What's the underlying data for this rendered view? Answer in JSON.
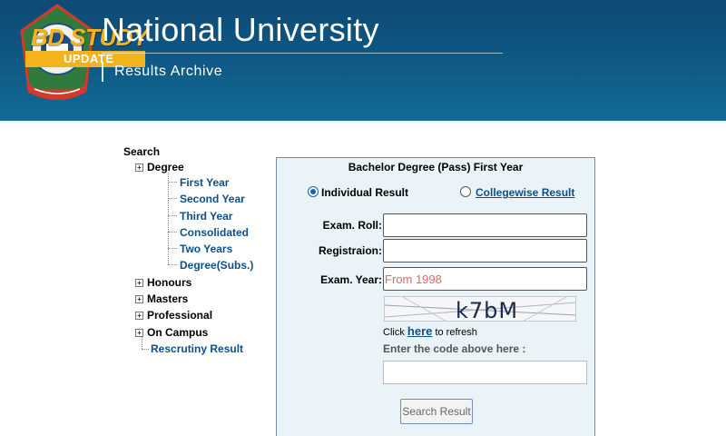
{
  "header": {
    "title": "National University",
    "subtitle": "Results Archive",
    "watermark": {
      "brand": "BD STUDY",
      "update": "UPDATE"
    }
  },
  "sidebar": {
    "root": "Search",
    "degree": {
      "label": "Degree",
      "items": [
        "First Year",
        "Second Year",
        "Third Year",
        "Consolidated",
        "Two Years",
        "Degree(Subs.)"
      ]
    },
    "categories": [
      "Honours",
      "Masters",
      "Professional",
      "On Campus"
    ],
    "rescrutiny": "Rescrutiny Result"
  },
  "form": {
    "title": "Bachelor Degree (Pass) First Year",
    "mode_individual": "Individual Result",
    "mode_collegewise": "Collegewise Result",
    "selected_mode": "Individual Result",
    "roll_label": "Exam. Roll:",
    "roll_value": "",
    "registration_label": "Registraion:",
    "registration_value": "",
    "year_label": "Exam. Year:",
    "year_placeholder": "From 1998",
    "captcha": "k7bM",
    "refresh_prefix": "Click",
    "refresh_link": "here",
    "refresh_suffix": "to refresh",
    "code_label": "Enter the code above here :",
    "code_value": "",
    "submit_label": "Search Result"
  },
  "colors": {
    "header_bg": "#0f5a86",
    "panel_bg": "#eaf3f8",
    "link": "#0d4f8a",
    "watermark": "#f2b31c"
  }
}
